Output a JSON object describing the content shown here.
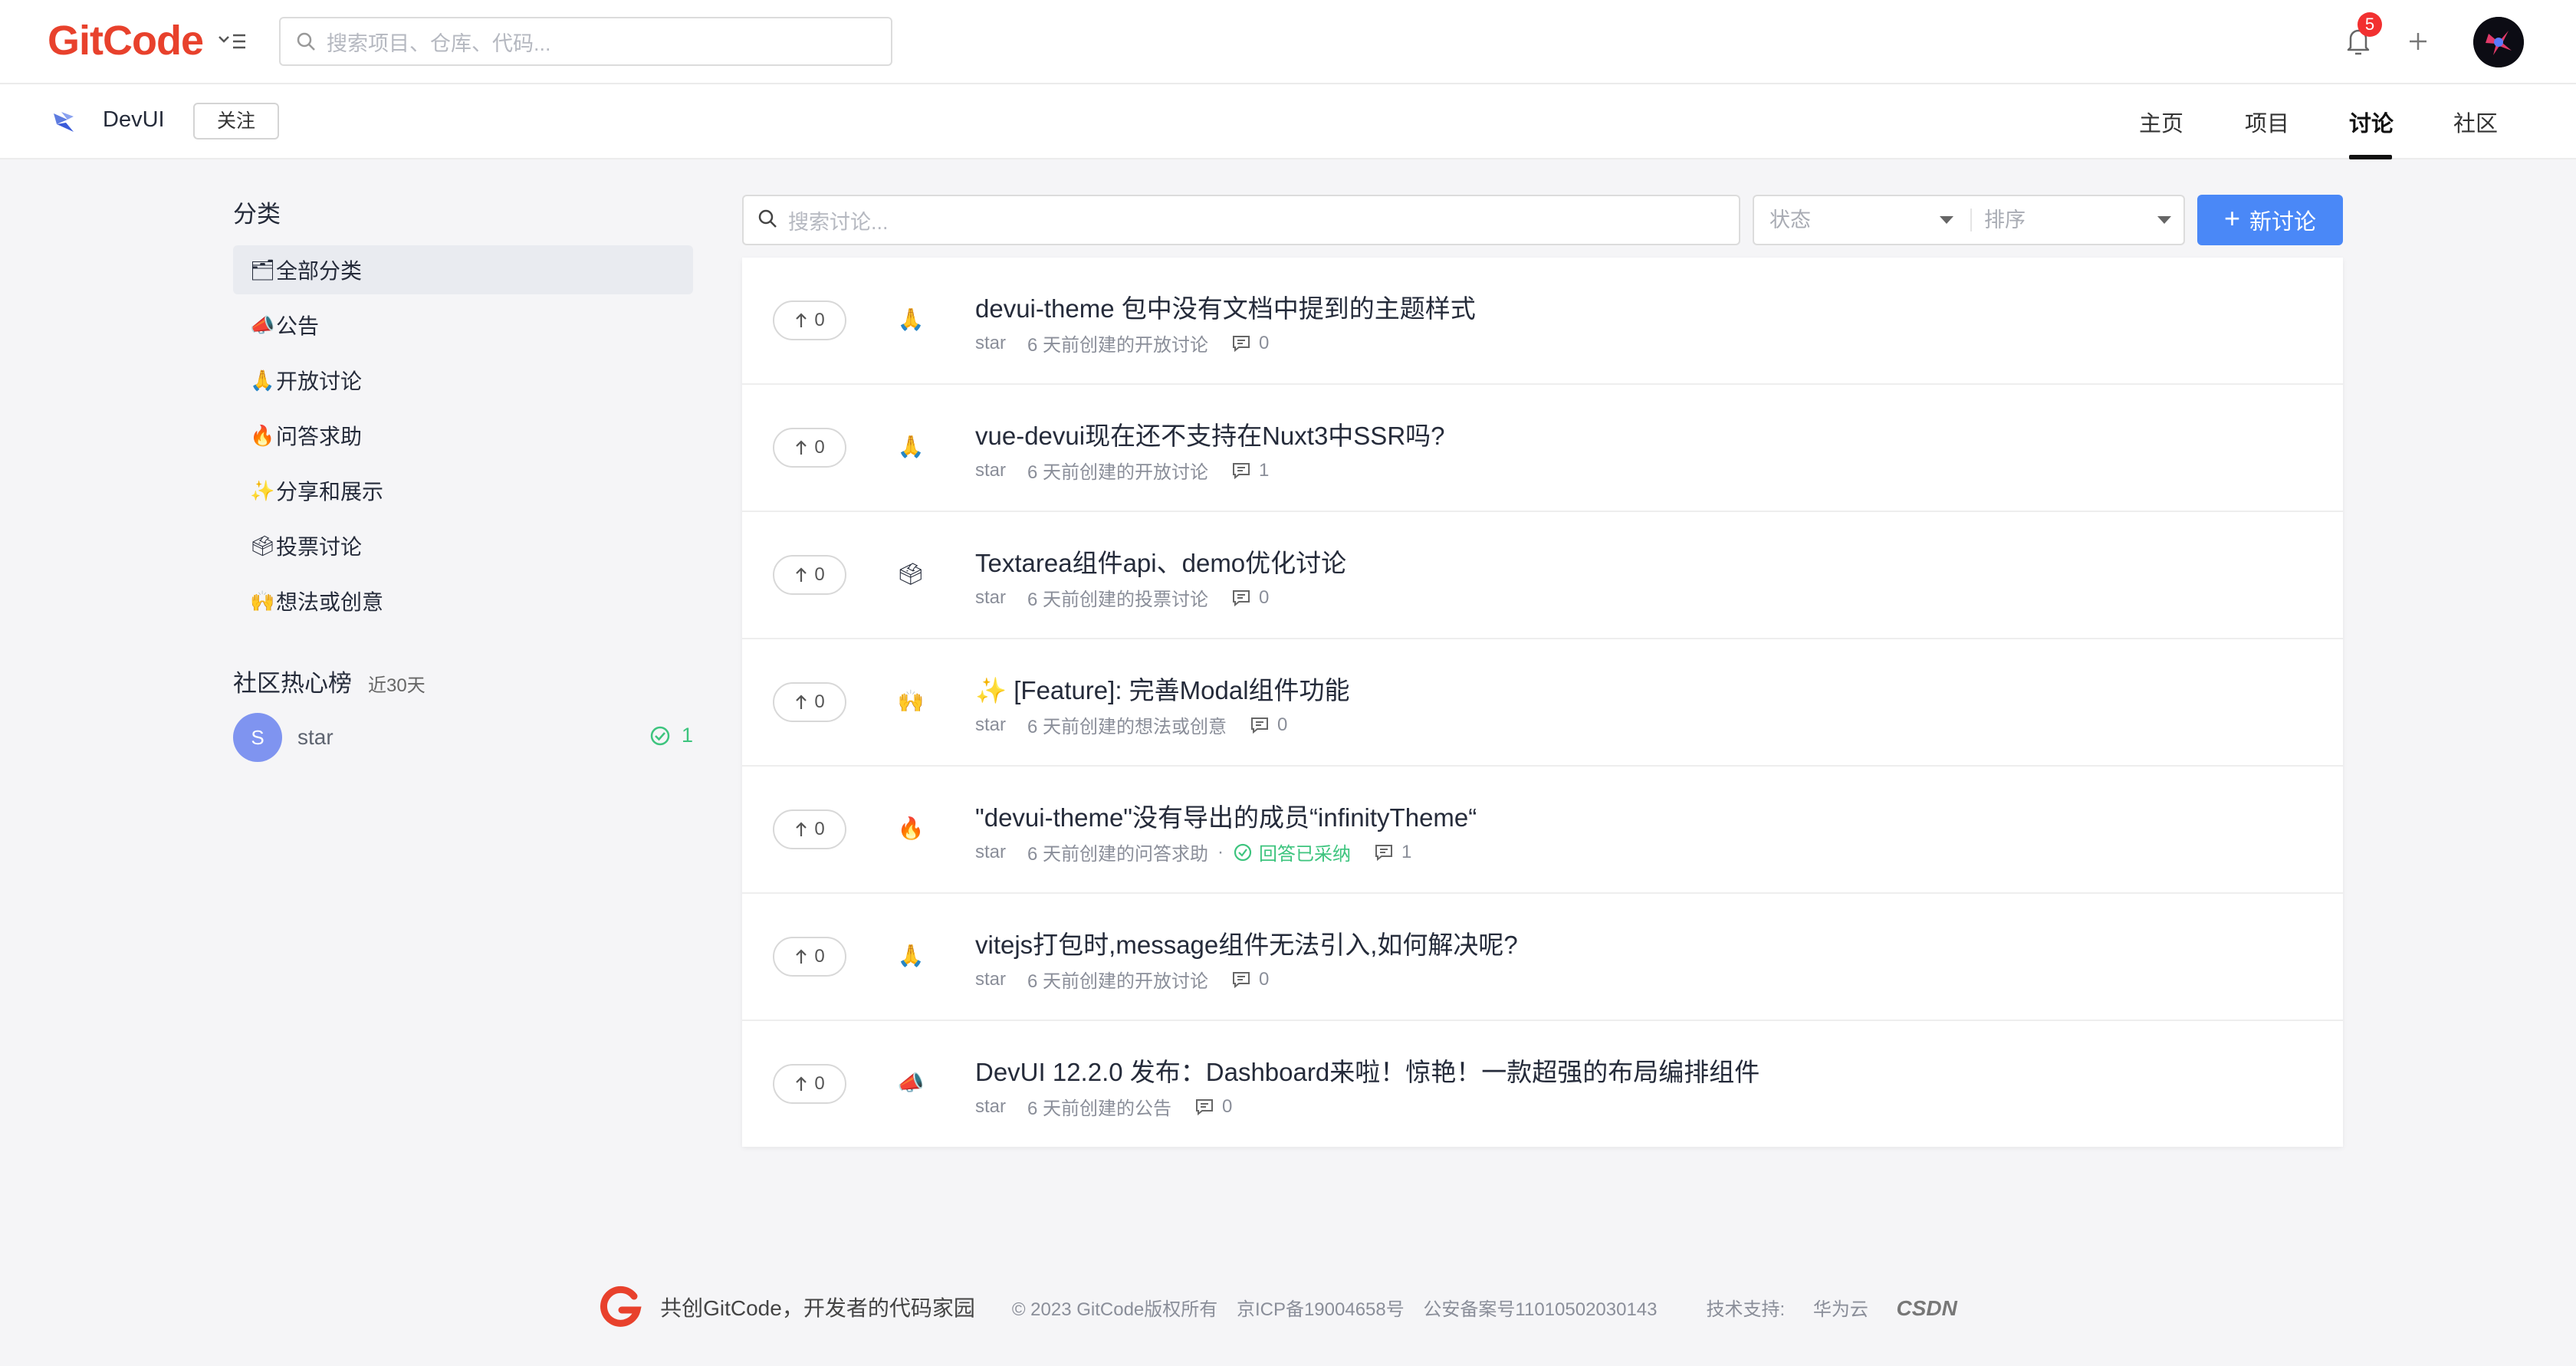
{
  "header": {
    "logo_git": "Git",
    "logo_code": "Code",
    "search_placeholder": "搜索项目、仓库、代码...",
    "notification_count": "5"
  },
  "project": {
    "name": "DevUI",
    "follow_label": "关注",
    "tabs": [
      {
        "label": "主页"
      },
      {
        "label": "项目"
      },
      {
        "label": "讨论"
      },
      {
        "label": "社区"
      }
    ],
    "active_tab": "讨论"
  },
  "sidebar": {
    "categories_title": "分类",
    "categories": [
      {
        "emoji": "🗂",
        "label": "全部分类"
      },
      {
        "emoji": "📣",
        "label": "公告"
      },
      {
        "emoji": "🙏",
        "label": "开放讨论"
      },
      {
        "emoji": "🔥",
        "label": "问答求助"
      },
      {
        "emoji": "✨",
        "label": "分享和展示"
      },
      {
        "emoji": "🗳",
        "label": "投票讨论"
      },
      {
        "emoji": "🙌",
        "label": "想法或创意"
      }
    ],
    "hot_title": "社区热心榜",
    "hot_period": "近30天",
    "hot_users": [
      {
        "initial": "S",
        "name": "star",
        "count": "1"
      }
    ]
  },
  "filters": {
    "search_placeholder": "搜索讨论...",
    "status_placeholder": "状态",
    "sort_placeholder": "排序",
    "new_button": "新讨论"
  },
  "discussions": [
    {
      "votes": "0",
      "emoji": "🙏",
      "title": "devui-theme 包中没有文档中提到的主题样式",
      "author": "star",
      "meta": "6 天前创建的开放讨论",
      "answered": "",
      "comments": "0"
    },
    {
      "votes": "0",
      "emoji": "🙏",
      "title": "vue-devui现在还不支持在Nuxt3中SSR吗?",
      "author": "star",
      "meta": "6 天前创建的开放讨论",
      "answered": "",
      "comments": "1"
    },
    {
      "votes": "0",
      "emoji": "🗳",
      "title": "Textarea组件api、demo优化讨论",
      "author": "star",
      "meta": "6 天前创建的投票讨论",
      "answered": "",
      "comments": "0"
    },
    {
      "votes": "0",
      "emoji": "🙌",
      "title": "✨ [Feature]: 完善Modal组件功能",
      "author": "star",
      "meta": "6 天前创建的想法或创意",
      "answered": "",
      "comments": "0"
    },
    {
      "votes": "0",
      "emoji": "🔥",
      "title": "\"devui-theme\"没有导出的成员“infinityTheme“",
      "author": "star",
      "meta": "6 天前创建的问答求助",
      "answered": "回答已采纳",
      "comments": "1"
    },
    {
      "votes": "0",
      "emoji": "🙏",
      "title": "vitejs打包时,message组件无法引入,如何解决呢?",
      "author": "star",
      "meta": "6 天前创建的开放讨论",
      "answered": "",
      "comments": "0"
    },
    {
      "votes": "0",
      "emoji": "📣",
      "title": "DevUI 12.2.0 发布：Dashboard来啦！惊艳！一款超强的布局编排组件",
      "author": "star",
      "meta": "6 天前创建的公告",
      "answered": "",
      "comments": "0"
    }
  ],
  "footer": {
    "slogan": "共创GitCode，开发者的代码家园",
    "copyright": "© 2023 GitCode版权所有",
    "icp": "京ICP备19004658号",
    "police": "公安备案号11010502030143",
    "support_label": "技术支持:",
    "support_huawei": "华为云",
    "support_csdn": "CSDN"
  },
  "colors": {
    "brand": "#e8412c",
    "primary": "#4a88f7",
    "success": "#3dc47e",
    "badge": "#f23030"
  }
}
